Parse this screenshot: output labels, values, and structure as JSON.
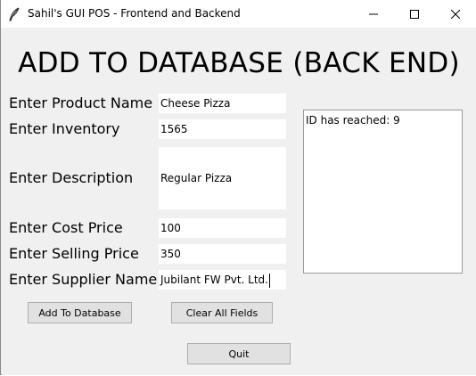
{
  "window": {
    "title": "Sahil's GUI POS - Frontend and Backend"
  },
  "heading": "ADD TO DATABASE (BACK END)",
  "form": {
    "product_name": {
      "label": "Enter Product Name",
      "value": "Cheese Pizza"
    },
    "inventory": {
      "label": "Enter Inventory",
      "value": "1565"
    },
    "description": {
      "label": "Enter Description",
      "value": "Regular Pizza"
    },
    "cost_price": {
      "label": "Enter Cost Price",
      "value": "100"
    },
    "selling_price": {
      "label": "Enter Selling Price",
      "value": "350"
    },
    "supplier_name": {
      "label": "Enter Supplier Name",
      "value": "Jubilant FW Pvt. Ltd."
    }
  },
  "output": {
    "text": "ID has reached: 9"
  },
  "buttons": {
    "add": "Add To Database",
    "clear": "Clear All Fields",
    "quit": "Quit"
  }
}
